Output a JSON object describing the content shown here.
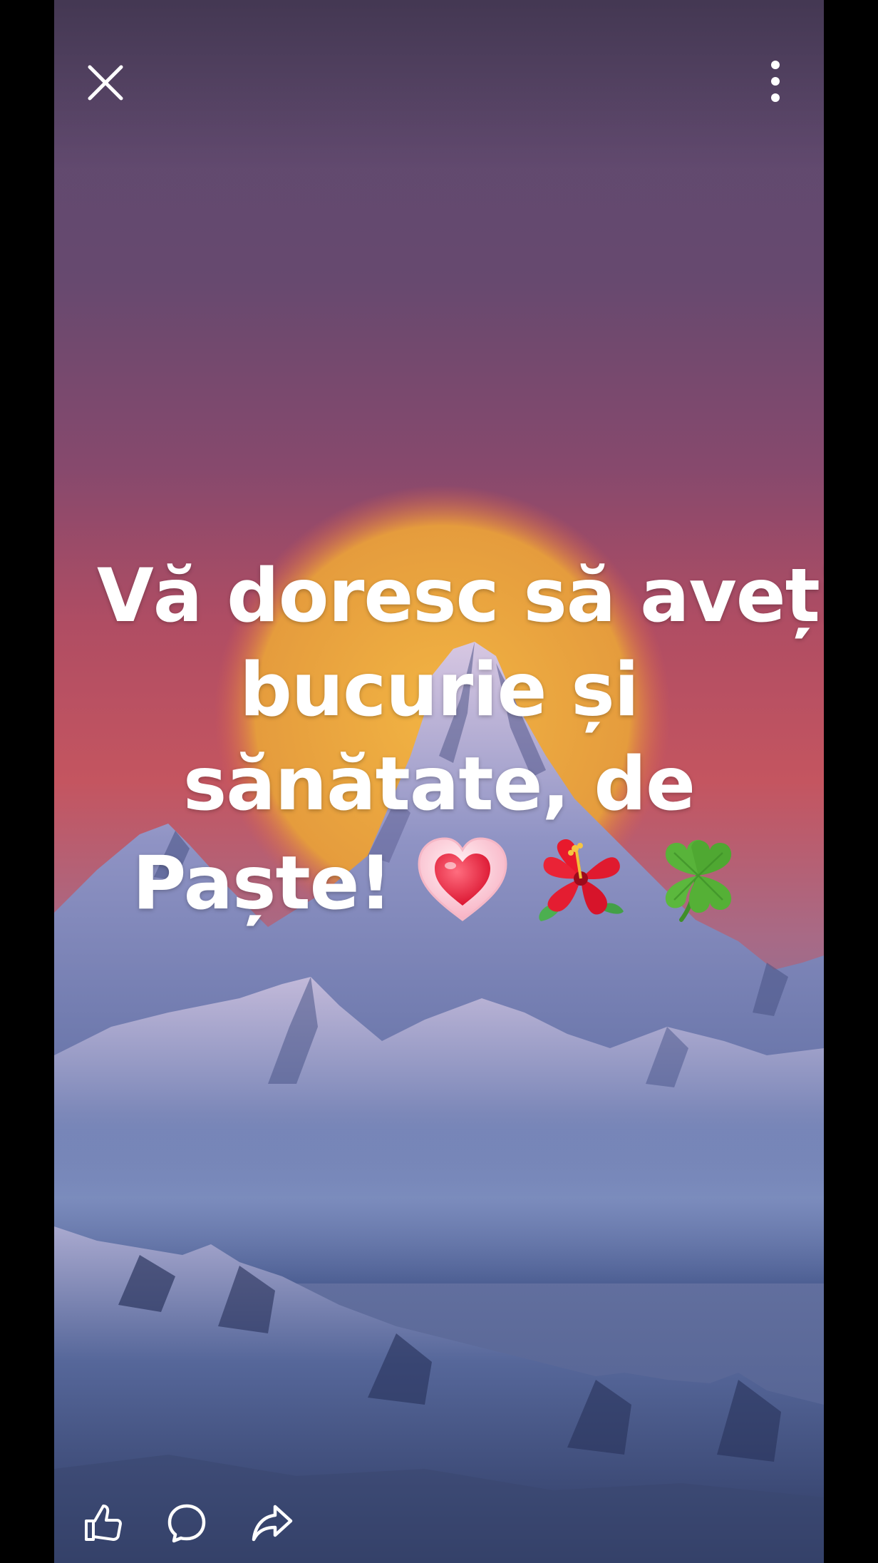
{
  "post": {
    "caption_lines": [
      "Vă doresc să aveți",
      "bucurie și",
      "sănătate, de",
      "Paște!"
    ],
    "emojis": [
      "heart-icon",
      "hibiscus-icon",
      "four-leaf-clover-icon"
    ]
  },
  "topbar": {
    "close_icon": "close-icon",
    "menu_icon": "more-vertical-icon"
  },
  "actions": [
    {
      "id": "like",
      "icon": "thumbs-up-icon"
    },
    {
      "id": "comment",
      "icon": "comment-bubble-icon"
    },
    {
      "id": "share",
      "icon": "share-arrow-icon"
    }
  ],
  "colors": {
    "sky_top": "#5a4a6e",
    "sky_glow": "#c44f5d",
    "sun": "#e3a43c",
    "mountain": "#4a5a8c",
    "text": "#ffffff",
    "frame": "#000000"
  }
}
